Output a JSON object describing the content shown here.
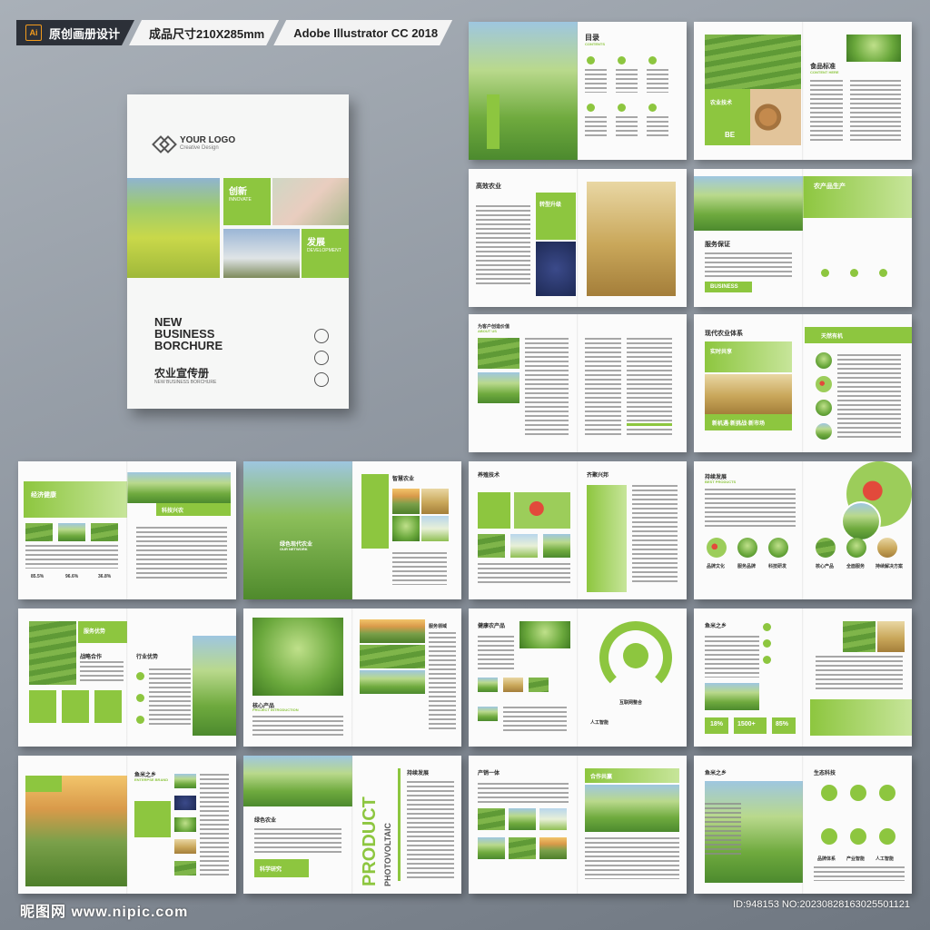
{
  "topbar": {
    "ai_badge": "Ai",
    "seg1": "原创画册设计",
    "seg2": "成品尺寸210X285mm",
    "seg3": "Adobe Illustrator CC 2018"
  },
  "cover": {
    "logo_name": "YOUR LOGO",
    "logo_sub": "Creative Design",
    "tile1": "创新",
    "tile1_sub": "INNOVATE",
    "tile2": "发展",
    "tile2_sub": "DEVELOPMENT",
    "title_line1": "NEW",
    "title_line2": "BUSINESS",
    "title_line3": "BORCHURE",
    "cn_title": "农业宣传册",
    "sub": "NEW BUSINESS BORCHURE"
  },
  "spreads": {
    "s1": {
      "h1": "目录",
      "h1_en": "CONTENTS"
    },
    "s2": {
      "h1": "食品标准",
      "h1_en": "CONTENT HERE",
      "badge": "BE",
      "sub": "农业技术"
    },
    "s3": {
      "h1": "高效农业",
      "h1_en": "FUTURE EXPECTATION",
      "tag": "转型升级"
    },
    "s4": {
      "h1": "农产品生产",
      "h2": "服务保证",
      "btn": "BUSINESS"
    },
    "s5": {
      "h1": "为客户创造价值",
      "h1_en": "ABOUT US"
    },
    "s6": {
      "h1": "现代农业体系",
      "h2": "实时共享",
      "h3": "天然有机",
      "h4": "新机遇·新挑战·新市场"
    },
    "s7": {
      "h1": "经济健康",
      "h2": "科技兴农",
      "p1": "85.5%",
      "p2": "96.6%",
      "p3": "36.8%"
    },
    "s8": {
      "h1": "智慧农业",
      "h2": "绿色现代农业",
      "h2_en": "OUR NETWORK"
    },
    "s9": {
      "h1": "养殖技术",
      "h2": "齐聚兴邦"
    },
    "s10": {
      "h1": "持续发展",
      "h1_en": "BEST PRODUCTS",
      "c1": "品牌文化",
      "c2": "服务品牌",
      "c3": "科技研发",
      "c4": "核心产品",
      "c5": "全面服务",
      "c6": "持续解决方案"
    },
    "s11": {
      "h1": "服务优势",
      "h2": "战略合作",
      "h3": "行业优势"
    },
    "s12": {
      "h1": "核心产品",
      "h1_en": "PROJECT INTRODUCTION",
      "h2": "服务领域"
    },
    "s13": {
      "h1": "健康农产品",
      "h2": "互联网整合",
      "h3": "人工智能"
    },
    "s14": {
      "h1": "鱼米之乡",
      "s1": "18%",
      "s2": "1500+",
      "s3": "85%"
    },
    "s15": {
      "h1": "鱼米之乡",
      "h1_en": "ENTERPSE BRAND"
    },
    "s16": {
      "h1": "绿色农业",
      "h2": "持续发展",
      "vert1": "PRODUCT",
      "vert2": "PHOTOVOLTAIC",
      "cta": "科学研究"
    },
    "s17": {
      "h1": "产销一体",
      "h2": "合作共赢"
    },
    "s18": {
      "h1": "鱼米之乡",
      "h2": "生态科技",
      "b1": "品牌体系",
      "b2": "产业智能",
      "b3": "人工智能"
    }
  },
  "footer": {
    "watermark": "昵图网 www.nipic.com",
    "id": "ID:948153 NO:20230828163025501121"
  },
  "colors": {
    "accent": "#8dc63f",
    "dark": "#2c3038",
    "background": "#8a929c"
  }
}
